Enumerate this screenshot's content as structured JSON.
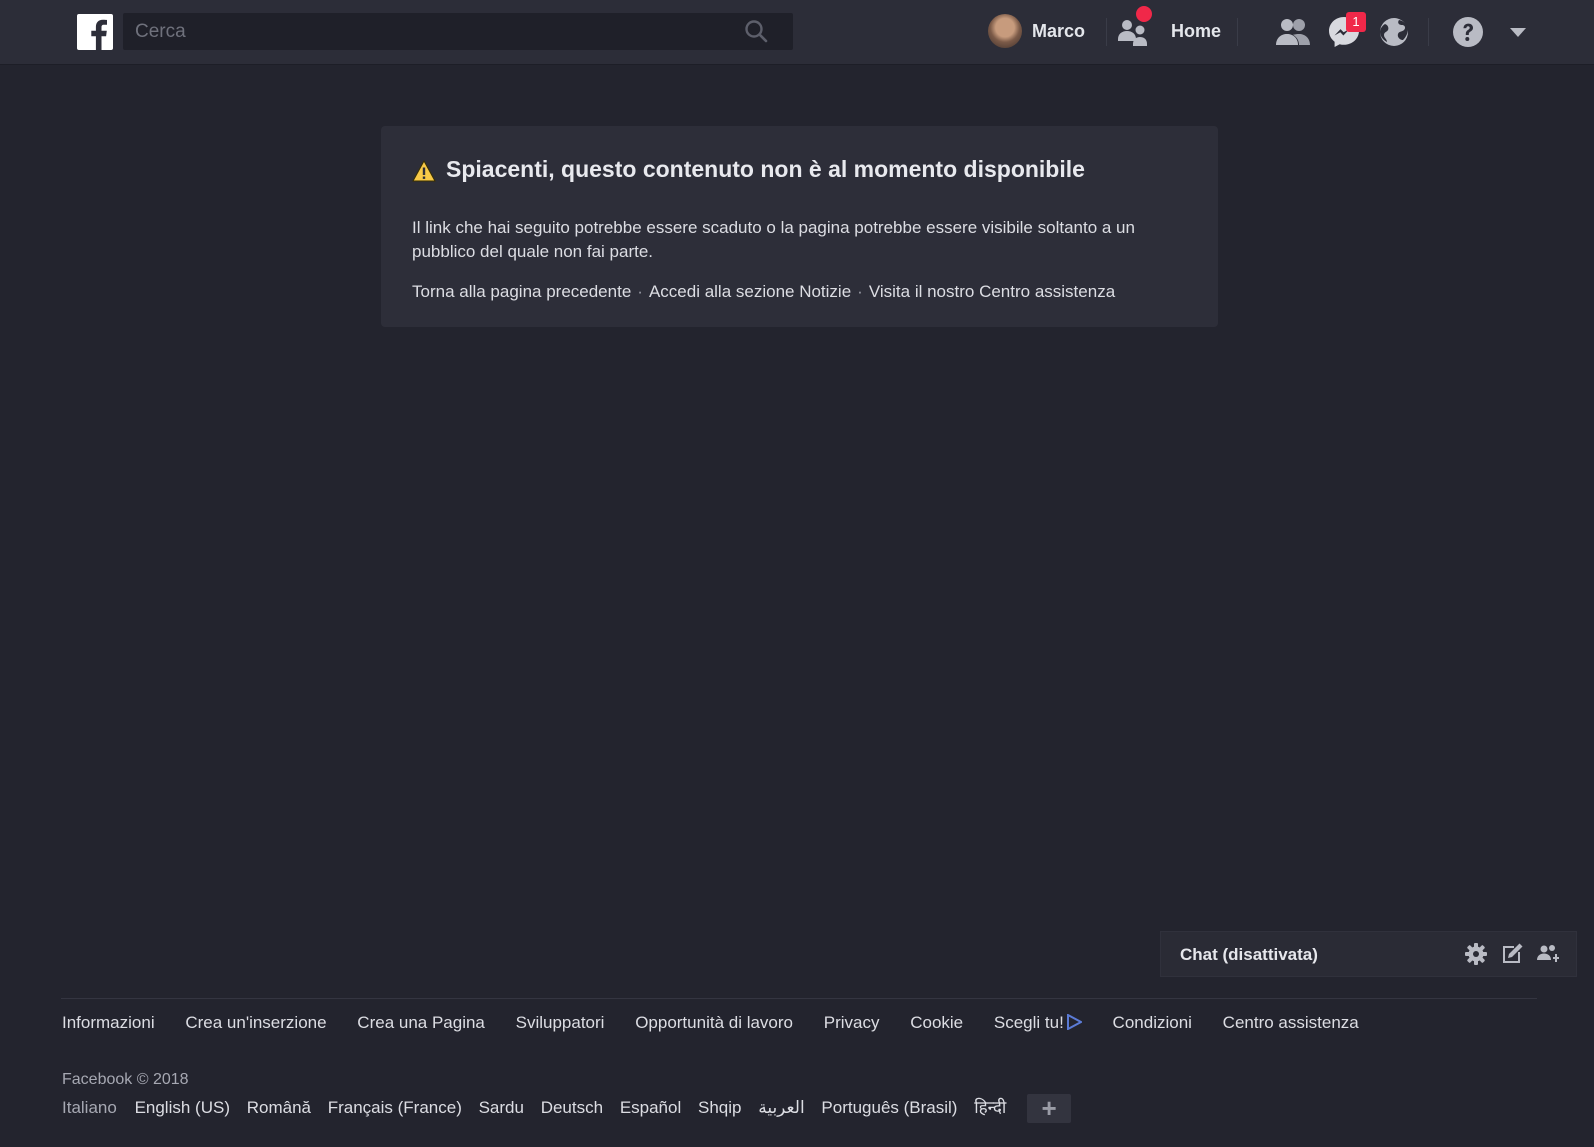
{
  "header": {
    "search_placeholder": "Cerca",
    "user_name": "Marco",
    "home_label": "Home",
    "messages_badge": "1"
  },
  "error": {
    "title": "Spiacenti, questo contenuto non è al momento disponibile",
    "body": "Il link che hai seguito potrebbe essere scaduto o la pagina potrebbe essere visibile soltanto a un pubblico del quale non fai parte.",
    "links": [
      "Torna alla pagina precedente",
      "Accedi alla sezione Notizie",
      "Visita il nostro Centro assistenza"
    ]
  },
  "chat": {
    "label": "Chat (disattivata)"
  },
  "footer": {
    "links": [
      "Informazioni",
      "Crea un'inserzione",
      "Crea una Pagina",
      "Sviluppatori",
      "Opportunità di lavoro",
      "Privacy",
      "Cookie",
      "Scegli tu!",
      "Condizioni",
      "Centro assistenza"
    ],
    "copyright": "Facebook © 2018",
    "current_language": "Italiano",
    "languages": [
      "English (US)",
      "Română",
      "Français (France)",
      "Sardu",
      "Deutsch",
      "Español",
      "Shqip",
      "العربية",
      "Português (Brasil)",
      "हिन्दी"
    ],
    "more_languages": "+"
  },
  "colors": {
    "background": "#23242e",
    "topbar": "#2c2d38",
    "card": "#2d2e39",
    "badge": "#f02849",
    "warning": "#f7c948",
    "adchoices": "#5b7bd6"
  },
  "icons": [
    "facebook-logo-icon",
    "search-icon",
    "friend-requests-icon",
    "find-friends-icon",
    "messenger-icon",
    "notifications-globe-icon",
    "help-icon",
    "account-menu-chevron-icon",
    "warning-icon",
    "settings-gear-icon",
    "new-message-icon",
    "create-group-icon",
    "adchoices-icon",
    "add-language-icon"
  ]
}
